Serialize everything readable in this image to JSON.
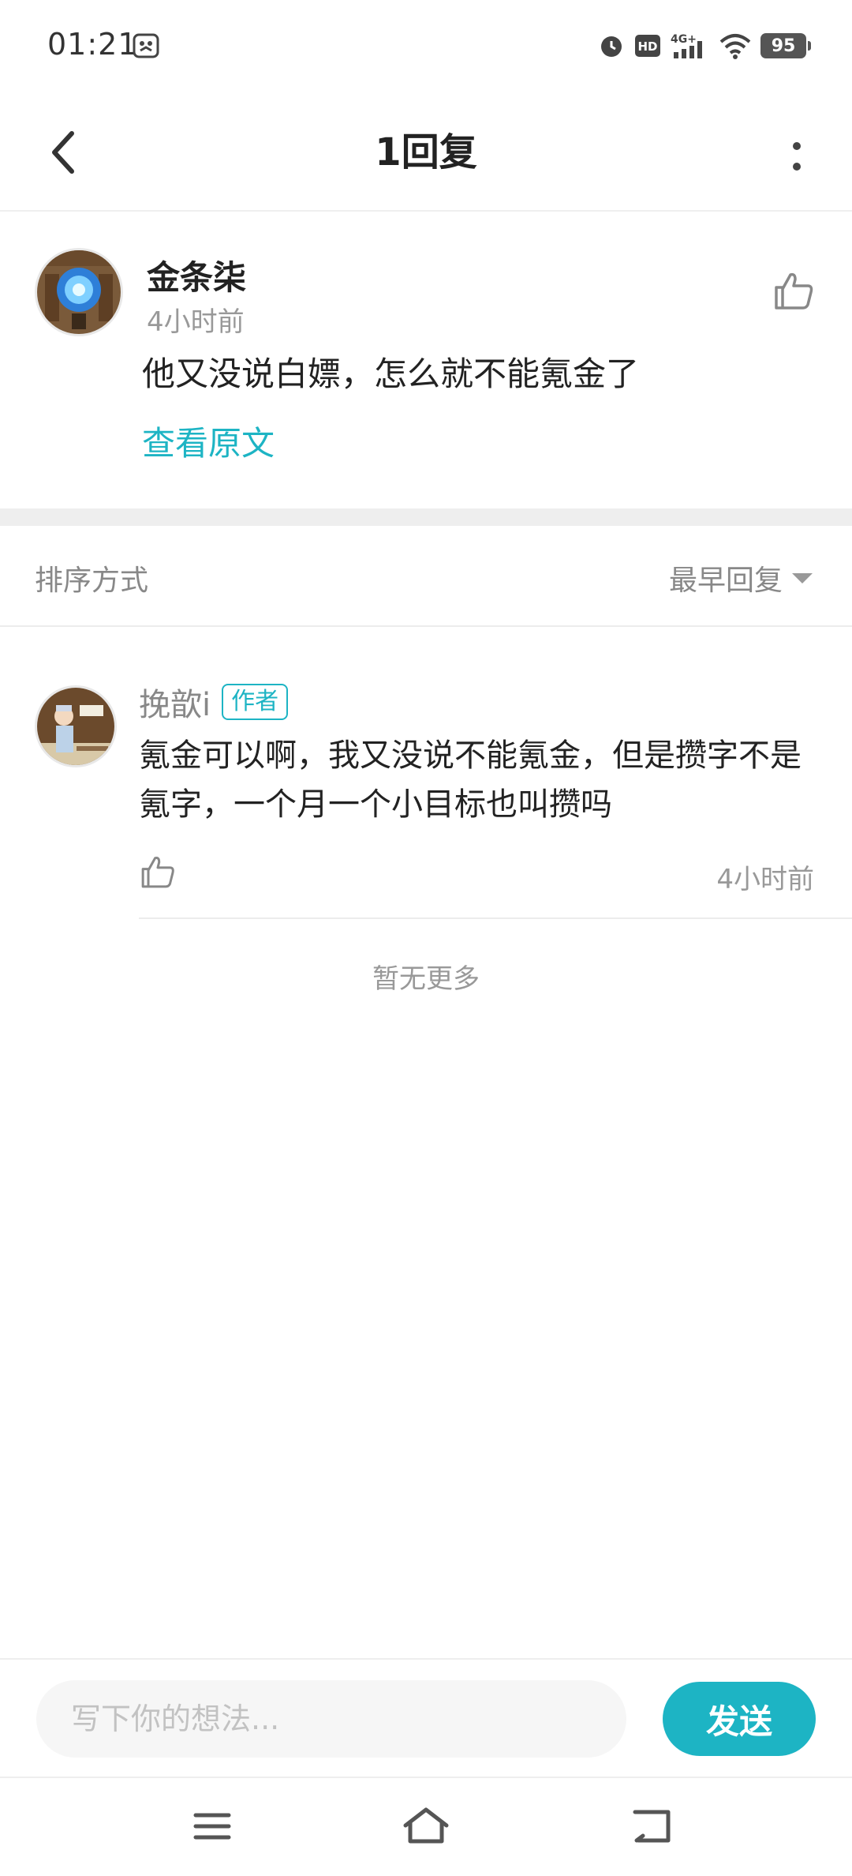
{
  "status_bar": {
    "time": "01:21",
    "battery": "95",
    "icons": [
      "app-notification-icon",
      "alarm-icon",
      "hd-icon",
      "4g-signal-icon",
      "wifi-icon",
      "battery-icon"
    ]
  },
  "header": {
    "title": "1回复",
    "back_icon": "chevron-left-icon",
    "more_icon": "more-vertical-icon"
  },
  "main_comment": {
    "username": "金条柒",
    "time": "4小时前",
    "text": "他又没说白嫖，怎么就不能氪金了",
    "view_original": "查看原文",
    "like_icon": "thumbs-up-icon"
  },
  "sort": {
    "label": "排序方式",
    "selected": "最早回复"
  },
  "reply": {
    "username": "挽歆i",
    "badge": "作者",
    "text": "氪金可以啊，我又没说不能氪金，但是攒字不是氪字，一个月一个小目标也叫攒吗",
    "time": "4小时前",
    "like_icon": "thumbs-up-icon"
  },
  "no_more": "暂无更多",
  "input": {
    "placeholder": "写下你的想法...",
    "value": "",
    "send_label": "发送"
  },
  "nav": {
    "icons": [
      "menu-icon",
      "home-icon",
      "back-icon"
    ]
  },
  "colors": {
    "accent": "#1db4c4",
    "text_primary": "#222222",
    "text_secondary": "#999999",
    "divider": "#eeeeee"
  }
}
